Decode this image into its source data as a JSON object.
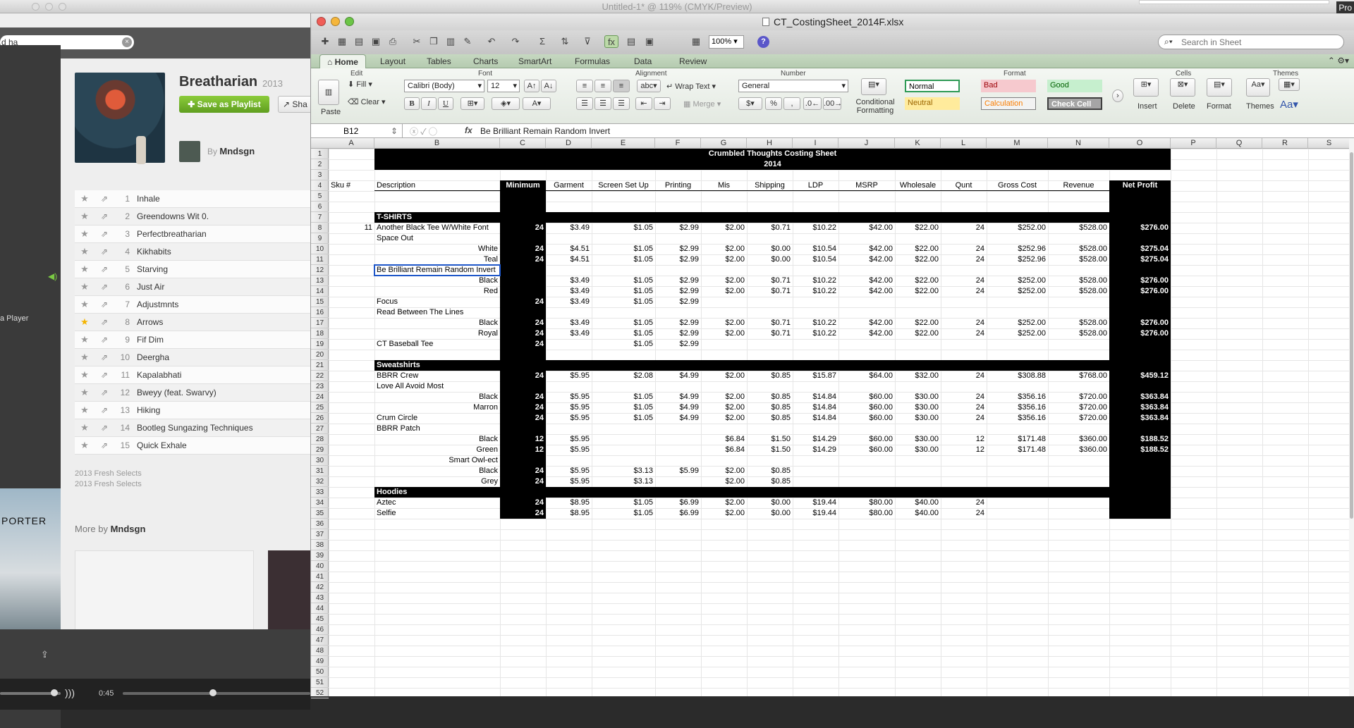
{
  "photoshop": {
    "title": "Untitled-1* @ 119% (CMYK/Preview)",
    "pro_label": "Pro"
  },
  "spotify": {
    "search_value": "d ha",
    "player_label": "a Player",
    "album": {
      "title": "Breatharian",
      "year": "2013",
      "save_button": "Save as Playlist",
      "share_button": "Sha",
      "by_label": "By",
      "artist": "Mndsgn"
    },
    "tracks": [
      {
        "n": "1",
        "title": "Inhale",
        "starred": false
      },
      {
        "n": "2",
        "title": "Greendowns Wit 0.",
        "starred": false
      },
      {
        "n": "3",
        "title": "Perfectbreatharian",
        "starred": false
      },
      {
        "n": "4",
        "title": "Kikhabits",
        "starred": false
      },
      {
        "n": "5",
        "title": "Starving",
        "starred": false
      },
      {
        "n": "6",
        "title": "Just Air",
        "starred": false
      },
      {
        "n": "7",
        "title": "Adjustmnts",
        "starred": false
      },
      {
        "n": "8",
        "title": "Arrows",
        "starred": true
      },
      {
        "n": "9",
        "title": "Fif Dim",
        "starred": false
      },
      {
        "n": "10",
        "title": "Deergha",
        "starred": false
      },
      {
        "n": "11",
        "title": "Kapalabhati",
        "starred": false
      },
      {
        "n": "12",
        "title": "Bweyy (feat. Swarvy)",
        "starred": false
      },
      {
        "n": "13",
        "title": "Hiking",
        "starred": false
      },
      {
        "n": "14",
        "title": "Bootleg Sungazing Techniques",
        "starred": false
      },
      {
        "n": "15",
        "title": "Quick Exhale",
        "starred": false
      }
    ],
    "credits": [
      "2013 Fresh Selects",
      "2013 Fresh Selects"
    ],
    "more_by_label": "More by",
    "more_by_artist": "Mndsgn",
    "porter_text": "PORTER",
    "time": "0:45",
    "progress_fraction": 0.48,
    "volume_fraction": 0.9
  },
  "excel": {
    "window_title": "CT_CostingSheet_2014F.xlsx",
    "zoom": "100%",
    "search_placeholder": "Search in Sheet",
    "tabs": [
      "Home",
      "Layout",
      "Tables",
      "Charts",
      "SmartArt",
      "Formulas",
      "Data",
      "Review"
    ],
    "ribbon": {
      "groups": [
        "Edit",
        "Font",
        "Alignment",
        "Number",
        "Format",
        "Cells",
        "Themes"
      ],
      "fill": "Fill",
      "clear": "Clear",
      "paste": "Paste",
      "font_name": "Calibri (Body)",
      "font_size": "12",
      "bold": "B",
      "italic": "I",
      "underline": "U",
      "wrap_text": "Wrap Text",
      "merge": "Merge",
      "abc": "abc",
      "number_format": "General",
      "percent": "%",
      "comma": ",",
      "conditional_formatting": "Conditional Formatting",
      "styles": [
        "Normal",
        "Bad",
        "Good",
        "Neutral",
        "Calculation",
        "Check Cell"
      ],
      "insert": "Insert",
      "delete": "Delete",
      "format": "Format",
      "themes": "Themes",
      "aa": "Aa"
    },
    "name_box": "B12",
    "formula": "Be Brilliant Remain Random Invert",
    "columns": [
      "A",
      "B",
      "C",
      "D",
      "E",
      "F",
      "G",
      "H",
      "I",
      "J",
      "K",
      "L",
      "M",
      "N",
      "O",
      "P",
      "Q",
      "R",
      "S"
    ],
    "rows": [
      "1",
      "2",
      "3",
      "4",
      "5",
      "6",
      "7",
      "8",
      "9",
      "10",
      "11",
      "12",
      "13",
      "14",
      "15",
      "16",
      "17",
      "18",
      "19",
      "20",
      "21",
      "22",
      "23",
      "24",
      "25",
      "26",
      "27",
      "28",
      "29",
      "30",
      "31",
      "32",
      "33",
      "34",
      "35",
      "36",
      "37",
      "38",
      "39",
      "40",
      "41",
      "42",
      "43",
      "44",
      "45",
      "46",
      "47",
      "48",
      "49",
      "50",
      "51",
      "52"
    ],
    "sheet_title": "Crumbled Thoughts Costing Sheet",
    "sheet_year": "2014",
    "headers": [
      "Sku #",
      "Description",
      "Minimum",
      "Garment",
      "Screen Set Up",
      "Printing",
      "Mis",
      "Shipping",
      "LDP",
      "MSRP",
      "Wholesale",
      "Qunt",
      "Gross Cost",
      "Revenue",
      "Net Profit"
    ],
    "sections": {
      "tshirts": "T-SHIRTS",
      "sweatshirts": "Sweatshirts",
      "hoodies": "Hoodies"
    },
    "data": [
      {
        "row": 8,
        "a": "11",
        "b": "Another Black Tee W/White Font",
        "ra": false,
        "c": "24",
        "d": "$3.49",
        "e": "$1.05",
        "f": "$2.99",
        "g": "$2.00",
        "h": "$0.71",
        "i": "$10.22",
        "j": "$42.00",
        "k": "$22.00",
        "l": "24",
        "m": "$252.00",
        "n": "$528.00",
        "o": "$276.00"
      },
      {
        "row": 9,
        "b": "Space Out",
        "ra": false
      },
      {
        "row": 10,
        "b": "White",
        "ra": true,
        "c": "24",
        "d": "$4.51",
        "e": "$1.05",
        "f": "$2.99",
        "g": "$2.00",
        "h": "$0.00",
        "i": "$10.54",
        "j": "$42.00",
        "k": "$22.00",
        "l": "24",
        "m": "$252.96",
        "n": "$528.00",
        "o": "$275.04"
      },
      {
        "row": 11,
        "b": "Teal",
        "ra": true,
        "c": "24",
        "d": "$4.51",
        "e": "$1.05",
        "f": "$2.99",
        "g": "$2.00",
        "h": "$0.00",
        "i": "$10.54",
        "j": "$42.00",
        "k": "$22.00",
        "l": "24",
        "m": "$252.96",
        "n": "$528.00",
        "o": "$275.04"
      },
      {
        "row": 12,
        "b": "Be Brilliant Remain Random Invert",
        "ra": false
      },
      {
        "row": 13,
        "b": "Black",
        "ra": true,
        "d": "$3.49",
        "e": "$1.05",
        "f": "$2.99",
        "g": "$2.00",
        "h": "$0.71",
        "i": "$10.22",
        "j": "$42.00",
        "k": "$22.00",
        "l": "24",
        "m": "$252.00",
        "n": "$528.00",
        "o": "$276.00"
      },
      {
        "row": 14,
        "b": "Red",
        "ra": true,
        "d": "$3.49",
        "e": "$1.05",
        "f": "$2.99",
        "g": "$2.00",
        "h": "$0.71",
        "i": "$10.22",
        "j": "$42.00",
        "k": "$22.00",
        "l": "24",
        "m": "$252.00",
        "n": "$528.00",
        "o": "$276.00"
      },
      {
        "row": 15,
        "b": "Focus",
        "ra": false,
        "c": "24",
        "d": "$3.49",
        "e": "$1.05",
        "f": "$2.99"
      },
      {
        "row": 16,
        "b": "Read Between The Lines",
        "ra": false
      },
      {
        "row": 17,
        "b": "Black",
        "ra": true,
        "c": "24",
        "d": "$3.49",
        "e": "$1.05",
        "f": "$2.99",
        "g": "$2.00",
        "h": "$0.71",
        "i": "$10.22",
        "j": "$42.00",
        "k": "$22.00",
        "l": "24",
        "m": "$252.00",
        "n": "$528.00",
        "o": "$276.00"
      },
      {
        "row": 18,
        "b": "Royal",
        "ra": true,
        "c": "24",
        "d": "$3.49",
        "e": "$1.05",
        "f": "$2.99",
        "g": "$2.00",
        "h": "$0.71",
        "i": "$10.22",
        "j": "$42.00",
        "k": "$22.00",
        "l": "24",
        "m": "$252.00",
        "n": "$528.00",
        "o": "$276.00"
      },
      {
        "row": 19,
        "b": "CT Baseball Tee",
        "ra": false,
        "c": "24",
        "e": "$1.05",
        "f": "$2.99"
      },
      {
        "row": 22,
        "b": "BBRR Crew",
        "ra": false,
        "c": "24",
        "d": "$5.95",
        "e": "$2.08",
        "f": "$4.99",
        "g": "$2.00",
        "h": "$0.85",
        "i": "$15.87",
        "j": "$64.00",
        "k": "$32.00",
        "l": "24",
        "m": "$308.88",
        "n": "$768.00",
        "o": "$459.12"
      },
      {
        "row": 23,
        "b": "Love All Avoid Most",
        "ra": false
      },
      {
        "row": 24,
        "b": "Black",
        "ra": true,
        "c": "24",
        "d": "$5.95",
        "e": "$1.05",
        "f": "$4.99",
        "g": "$2.00",
        "h": "$0.85",
        "i": "$14.84",
        "j": "$60.00",
        "k": "$30.00",
        "l": "24",
        "m": "$356.16",
        "n": "$720.00",
        "o": "$363.84"
      },
      {
        "row": 25,
        "b": "Marron",
        "ra": true,
        "c": "24",
        "d": "$5.95",
        "e": "$1.05",
        "f": "$4.99",
        "g": "$2.00",
        "h": "$0.85",
        "i": "$14.84",
        "j": "$60.00",
        "k": "$30.00",
        "l": "24",
        "m": "$356.16",
        "n": "$720.00",
        "o": "$363.84"
      },
      {
        "row": 26,
        "b": "Crum Circle",
        "ra": false,
        "c": "24",
        "d": "$5.95",
        "e": "$1.05",
        "f": "$4.99",
        "g": "$2.00",
        "h": "$0.85",
        "i": "$14.84",
        "j": "$60.00",
        "k": "$30.00",
        "l": "24",
        "m": "$356.16",
        "n": "$720.00",
        "o": "$363.84"
      },
      {
        "row": 27,
        "b": "BBRR Patch",
        "ra": false
      },
      {
        "row": 28,
        "b": "Black",
        "ra": true,
        "c": "12",
        "d": "$5.95",
        "g": "$6.84",
        "h": "$1.50",
        "i": "$14.29",
        "j": "$60.00",
        "k": "$30.00",
        "l": "12",
        "m": "$171.48",
        "n": "$360.00",
        "o": "$188.52"
      },
      {
        "row": 29,
        "b": "Green",
        "ra": true,
        "c": "12",
        "d": "$5.95",
        "g": "$6.84",
        "h": "$1.50",
        "i": "$14.29",
        "j": "$60.00",
        "k": "$30.00",
        "l": "12",
        "m": "$171.48",
        "n": "$360.00",
        "o": "$188.52"
      },
      {
        "row": 30,
        "b": "Smart Owl-ect",
        "ra": true
      },
      {
        "row": 31,
        "b": "Black",
        "ra": true,
        "c": "24",
        "d": "$5.95",
        "e": "$3.13",
        "f": "$5.99",
        "g": "$2.00",
        "h": "$0.85"
      },
      {
        "row": 32,
        "b": "Grey",
        "ra": true,
        "c": "24",
        "d": "$5.95",
        "e": "$3.13",
        "g": "$2.00",
        "h": "$0.85"
      },
      {
        "row": 34,
        "b": "Aztec",
        "ra": false,
        "c": "24",
        "d": "$8.95",
        "e": "$1.05",
        "f": "$6.99",
        "g": "$2.00",
        "h": "$0.00",
        "i": "$19.44",
        "j": "$80.00",
        "k": "$40.00",
        "l": "24"
      },
      {
        "row": 35,
        "b": "Selfie",
        "ra": false,
        "c": "24",
        "d": "$8.95",
        "e": "$1.05",
        "f": "$6.99",
        "g": "$2.00",
        "h": "$0.00",
        "i": "$19.44",
        "j": "$80.00",
        "k": "$40.00",
        "l": "24"
      }
    ]
  }
}
